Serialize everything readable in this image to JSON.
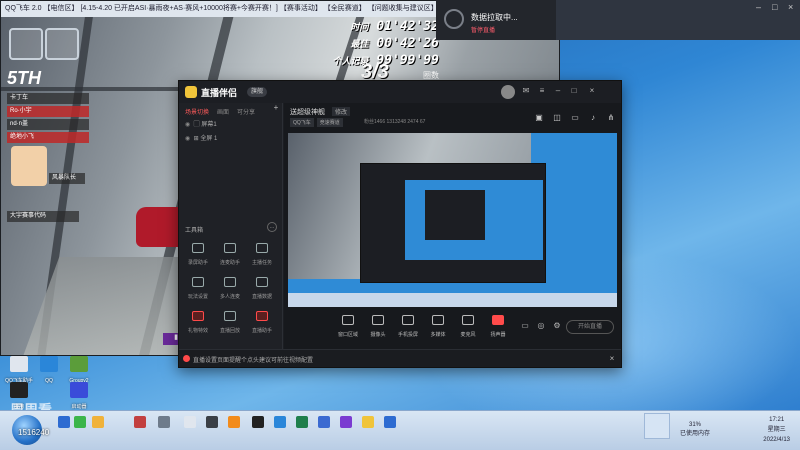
{
  "game": {
    "title": "QQ飞车 2.0 【电信区】 [4.15-4.20 已开启ASI·暴雨夜+AS·赛风+10000将赛+今赛开赛！] 【赛事活动】 【全民赛道】 【问题收集与建议区】",
    "rank": "5TH",
    "players": [
      "卡丁车",
      "Ro·小宇",
      "nd·n盖",
      "绝地小飞"
    ],
    "player_tag": "风暴队长",
    "bottom_left": "大宇赛事代码",
    "timer_time": "01'42'32",
    "timer_time_label": "时间",
    "timer_best": "00'42'26",
    "timer_best_label": "最佳",
    "timer_record": "99'99'99",
    "timer_record_label": "个人记录",
    "laps": "3/3",
    "laps_label": "圈数"
  },
  "notification": {
    "title": "数据拉取中...",
    "subtitle": "暂停直播"
  },
  "app": {
    "name": "直播伴侣",
    "badge": "旗舰",
    "tabs": [
      "场景切换",
      "画面",
      "可分享"
    ],
    "sources": [
      "屏幕1",
      "全屏 1"
    ],
    "tools_title": "工具箱",
    "tools_more": "...",
    "tools": [
      {
        "label": "录屏助手",
        "icon": "record-icon",
        "red": false
      },
      {
        "label": "连麦助手",
        "icon": "link-mic-icon",
        "red": false
      },
      {
        "label": "主播任务",
        "icon": "task-icon",
        "red": false
      },
      {
        "label": "玩法设置",
        "icon": "gameplay-icon",
        "red": false
      },
      {
        "label": "多人连麦",
        "icon": "multi-mic-icon",
        "red": false
      },
      {
        "label": "直播数据",
        "icon": "data-icon",
        "red": false
      },
      {
        "label": "礼物特效",
        "icon": "gift-icon",
        "red": true
      },
      {
        "label": "直播回放",
        "icon": "replay-icon",
        "red": false
      },
      {
        "label": "直播助手",
        "icon": "assistant-icon",
        "red": true
      }
    ],
    "room": {
      "title": "送超级神舰",
      "edit": "修改",
      "tags": [
        "QQ飞车",
        "竞速赛道"
      ],
      "stats": "粉丝1466   1313248   2474   67"
    },
    "bottom_tools": [
      {
        "label": "窗口区域",
        "icon": "window-capture-icon"
      },
      {
        "label": "摄像头",
        "icon": "camera-icon"
      },
      {
        "label": "手机投屏",
        "icon": "phone-cast-icon"
      },
      {
        "label": "多媒体",
        "icon": "media-icon"
      },
      {
        "label": "麦克风",
        "icon": "microphone-icon"
      },
      {
        "label": "扬声器",
        "icon": "speaker-icon"
      }
    ],
    "start_live": "开始直播",
    "status": "直播设置页面提醒个点头建议可前往视频配置"
  },
  "desktop": {
    "icons": [
      "QQ飞车助手",
      "QQ",
      "Groupy2",
      "应用",
      "启动器"
    ],
    "caption_big": "周周看",
    "caption_small": "1516240"
  },
  "taskbar": {
    "time": "17:21",
    "weekday": "星期三",
    "date": "2022/4/13",
    "net": "31%",
    "net2": "已使用内存"
  }
}
